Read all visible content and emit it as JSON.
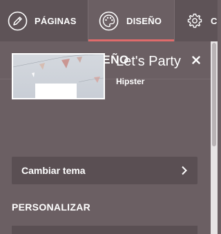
{
  "topnav": {
    "tabs": [
      {
        "label": "PÁGINAS",
        "icon": "pencil-icon",
        "active": false
      },
      {
        "label": "DISEÑO",
        "icon": "palette-icon",
        "active": true
      },
      {
        "label": "C",
        "icon": "gear-icon",
        "active": false
      }
    ]
  },
  "panel": {
    "title": "DISEÑO",
    "theme": {
      "name": "Let's Party",
      "style": "Hipster"
    },
    "change_theme_label": "Cambiar tema",
    "section_title": "PERSONALIZAR"
  },
  "colors": {
    "nav_bg": "#5e5357",
    "panel_bg": "#6b5f63",
    "button_bg": "#5a4f53",
    "accent": "#e06b6b"
  }
}
